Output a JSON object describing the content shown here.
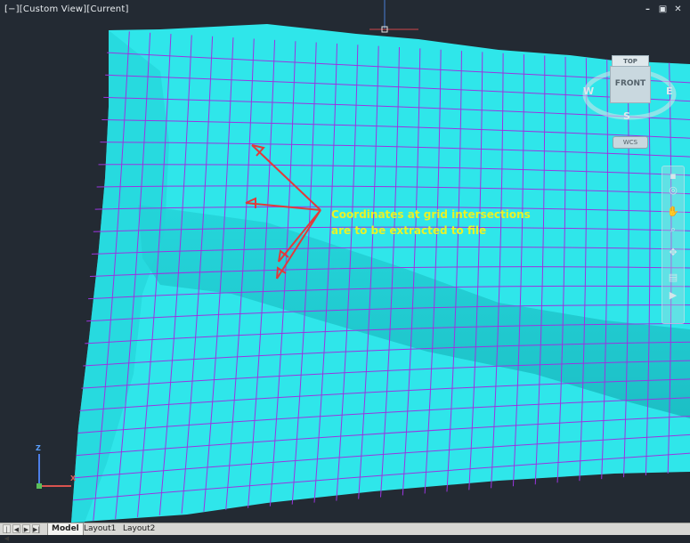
{
  "viewport": {
    "view_label": "[−][Custom View][Current]",
    "window_controls": {
      "minimize": "–",
      "restore": "▣",
      "close": "✕"
    }
  },
  "annotation": {
    "line1": "Coordinates at grid intersections",
    "line2": "are to be extracted to file"
  },
  "viewcube": {
    "top_label": "TOP",
    "front_label": "FRONT",
    "west": "W",
    "east": "E",
    "south": "S",
    "wcs_label": "WCS"
  },
  "ucs": {
    "z_label": "Z",
    "x_label": "X"
  },
  "tabs": {
    "nav": [
      "|◀",
      "◀",
      "▶",
      "▶|"
    ],
    "items": [
      "Model",
      "Layout1",
      "Layout2"
    ],
    "active": "Model"
  },
  "colors": {
    "surface": "#2ee6ea",
    "grid": "#9b35e0",
    "arrows": "#e23a3a",
    "annotation": "#e9f227",
    "background": "#232a33"
  }
}
